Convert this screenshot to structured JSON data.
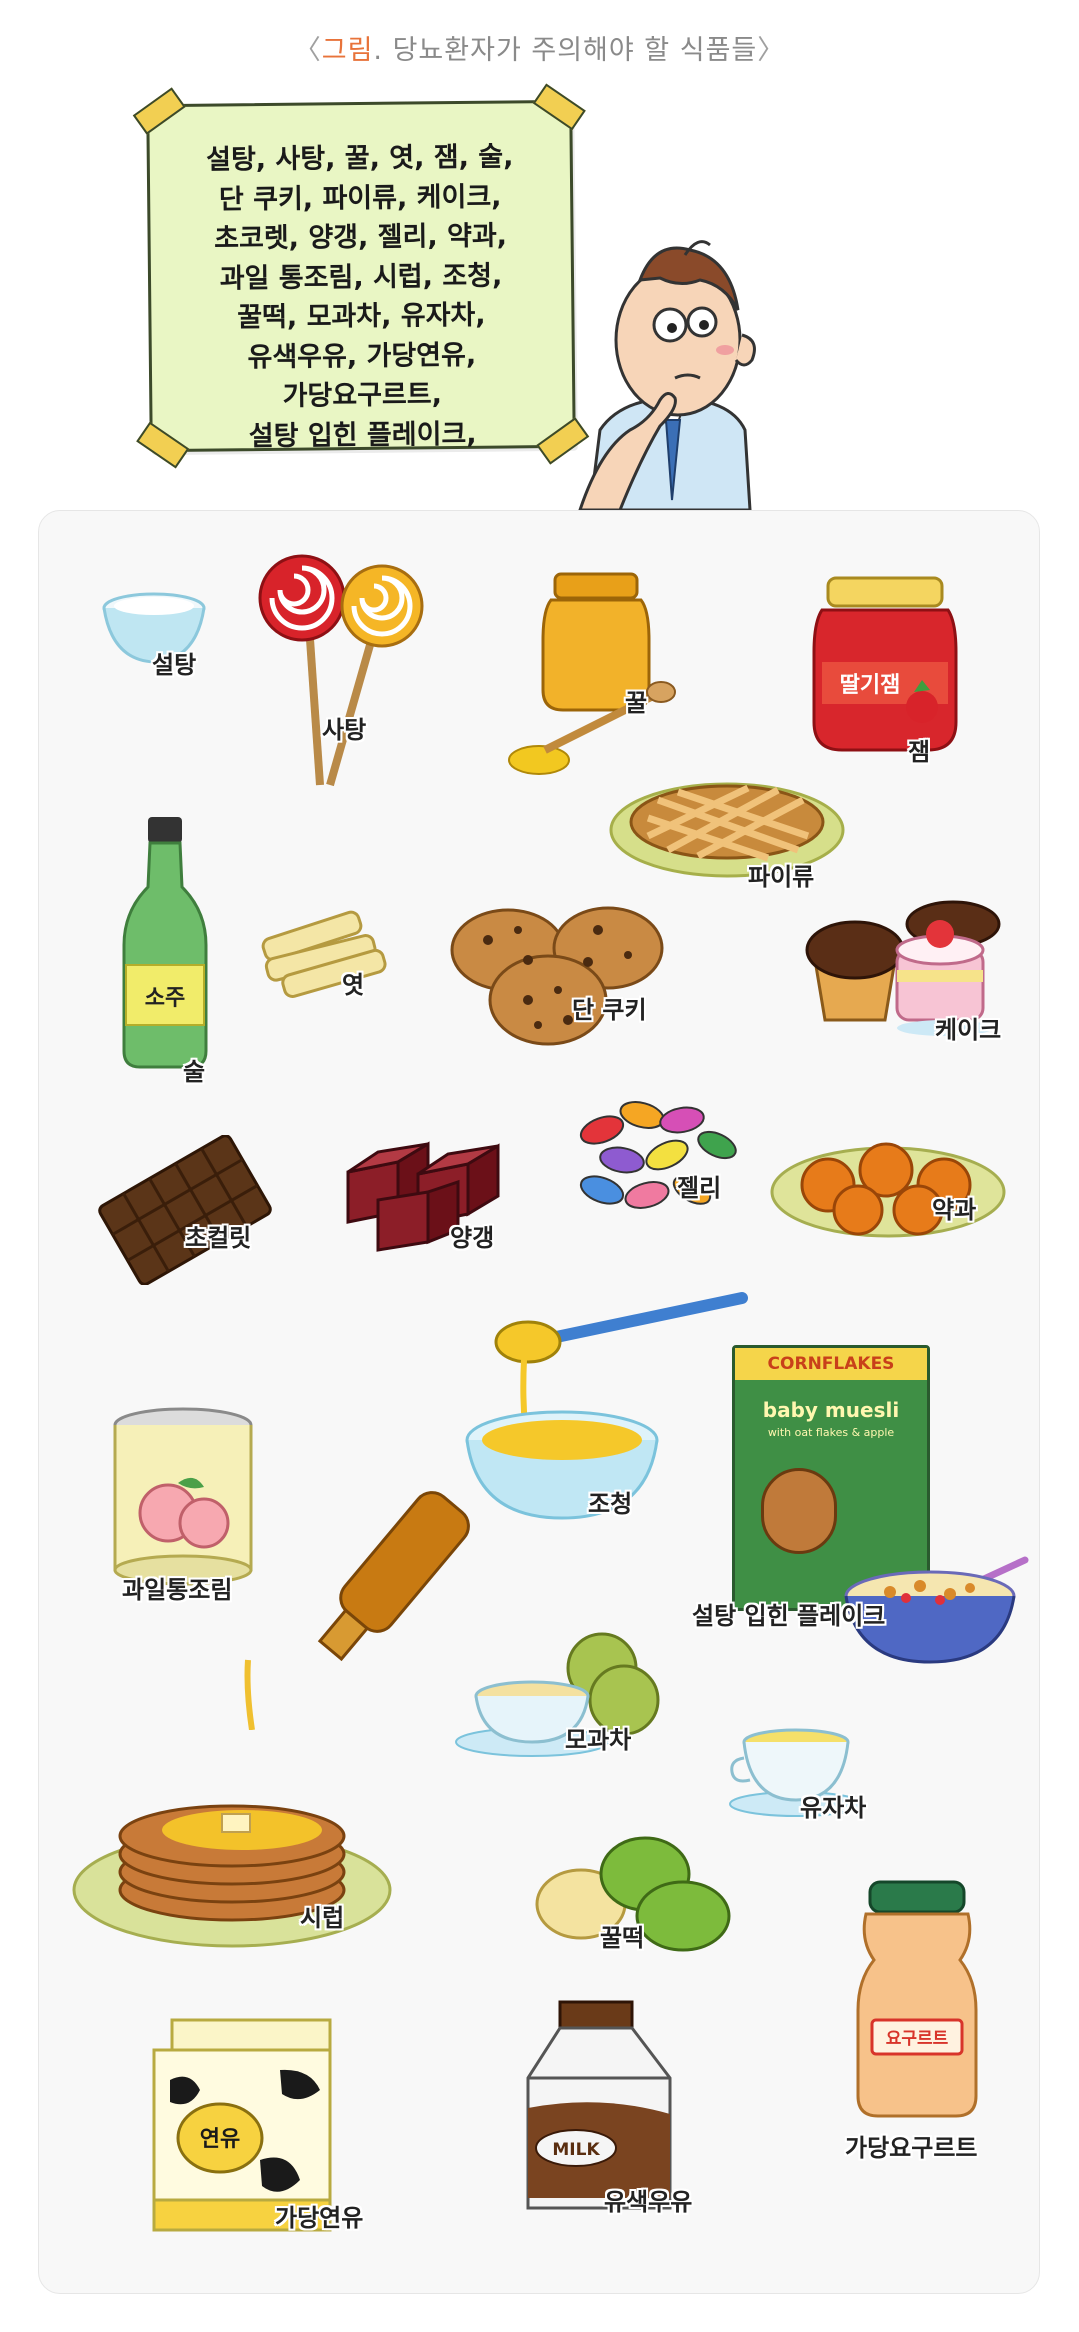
{
  "caption": {
    "open": "〈",
    "highlight": "그림",
    "rest": ". 당뇨환자가 주의해야 할 식품들",
    "close": "〉"
  },
  "note": {
    "lines": [
      "설탕, 사탕, 꿀, 엿, 잼, 술,",
      "단 쿠키, 파이류, 케이크,",
      "초코렛, 양갱, 젤리, 약과,",
      "과일 통조림, 시럽, 조청,",
      "꿀떡, 모과차, 유자차,",
      "유색우유, 가당연유,",
      "가당요구르트,",
      "설탕 입힌 플레이크,"
    ]
  },
  "foods": {
    "sugar": "설탕",
    "candy": "사탕",
    "honey": "꿀",
    "jam": "잼",
    "jam_jar_text": "딸기잼",
    "pie": "파이류",
    "soju": "술",
    "soju_bottle_text": "소주",
    "yeot": "엿",
    "cookie": "단 쿠키",
    "cake": "케이크",
    "chocolate": "초컬릿",
    "yanggaeng": "양갱",
    "jelly": "젤리",
    "yakgwa": "약과",
    "jocheong": "조청",
    "flakes": "설탕 입힌 플레이크",
    "flakes_box_title": "CORNFLAKES",
    "flakes_box_sub": "baby muesli",
    "flakes_box_desc": "with oat flakes & apple",
    "canned_fruit": "과일통조림",
    "moguacha": "모과차",
    "yujacha": "유자차",
    "syrup": "시럽",
    "ggultteok": "꿀떡",
    "yogurt": "가당요구르트",
    "yogurt_bottle_text": "요구르트",
    "condensed_milk": "가당연유",
    "condensed_can_text": "연유",
    "flavored_milk": "유색우유",
    "milk_carton_text": "MILK"
  },
  "colors": {
    "caption_highlight": "#e8733a",
    "note_bg": "#e9f6c4",
    "tape": "#f2cf52",
    "panel_bg": "#f8f8f8"
  }
}
